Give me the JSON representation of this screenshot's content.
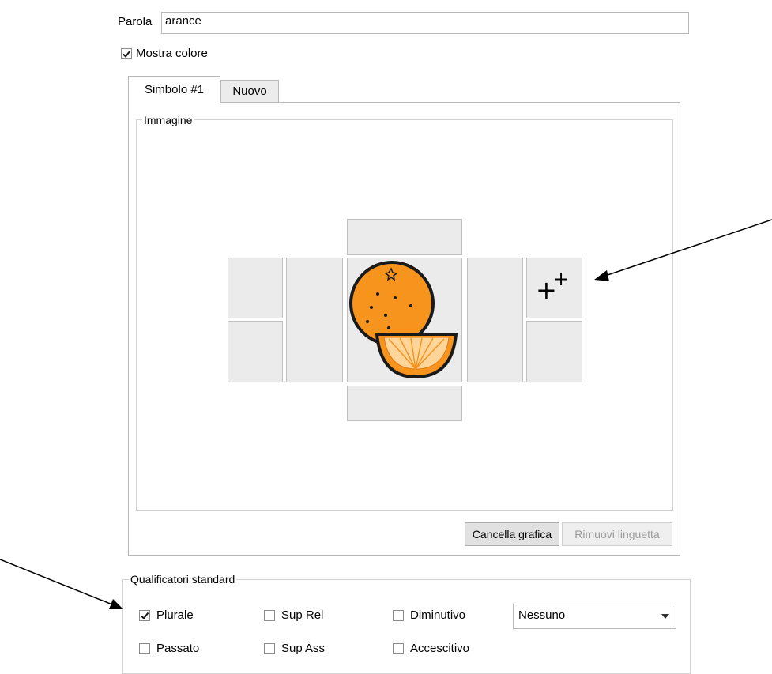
{
  "word": {
    "label": "Parola",
    "value": "arance"
  },
  "show_color": {
    "label": "Mostra colore",
    "checked": true
  },
  "tabs": [
    {
      "label": "Simbolo #1",
      "active": true
    },
    {
      "label": "Nuovo",
      "active": false
    }
  ],
  "image_group": {
    "title": "Immagine",
    "center_symbol": "orange-symbol-icon",
    "add_slot_glyph": "+",
    "add_slot_glyph_small": "+"
  },
  "buttons": {
    "clear_graphic": "Cancella grafica",
    "remove_tab": "Rimuovi linguetta"
  },
  "qualifiers": {
    "title": "Qualificatori standard",
    "plurale": {
      "label": "Plurale",
      "checked": true
    },
    "sup_rel": {
      "label": "Sup Rel",
      "checked": false
    },
    "diminutivo": {
      "label": "Diminutivo",
      "checked": false
    },
    "passato": {
      "label": "Passato",
      "checked": false
    },
    "sup_ass": {
      "label": "Sup Ass",
      "checked": false
    },
    "accescitivo": {
      "label": "Accescitivo",
      "checked": false
    },
    "dropdown": {
      "selected": "Nessuno"
    }
  },
  "colors": {
    "orange": "#f7941d",
    "outline": "#1a1a1a",
    "slot": "#ebebeb"
  }
}
